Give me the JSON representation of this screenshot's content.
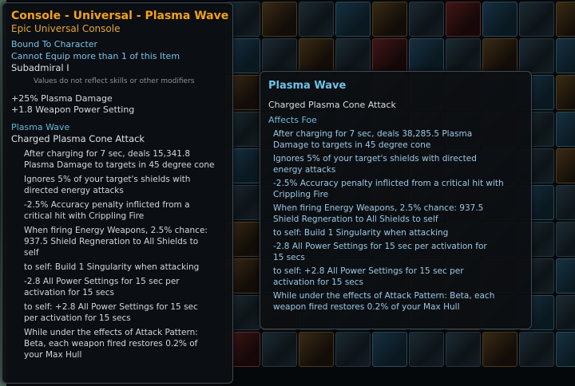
{
  "item_tooltip": {
    "title": "Console - Universal - Plasma Wave",
    "rarity": "Epic Universal Console",
    "binding": "Bound To Character",
    "equip_limit": "Cannot Equip more than 1 of this Item",
    "rank": "Subadmiral I",
    "note": "Values do not reflect skills or other modifiers",
    "bonuses": [
      "+25% Plasma Damage",
      "+1.8 Weapon Power Setting"
    ],
    "ability_name": "Plasma Wave",
    "ability_type": "Charged Plasma Cone Attack",
    "effects": [
      "After charging for 7 sec, deals 15,341.8\nPlasma Damage to targets in 45 degree cone",
      "Ignores 5% of your target's shields with\ndirected energy attacks",
      "-2.5% Accuracy penalty inflicted from a\ncritical hit with Crippling Fire",
      "When firing Energy Weapons, 2.5% chance:\n937.5 Shield Regneration to All Shields to\nself",
      "to self: Build 1 Singularity when attacking",
      "-2.8 All Power Settings for 15 sec per\nactivation for 15 secs",
      "to self: +2.8 All Power Settings for 15 sec\nper activation for 15 secs",
      "While under the effects of Attack Pattern:\nBeta, each weapon fired restores 0.2% of\nyour Max Hull"
    ]
  },
  "ability_tooltip": {
    "title": "Plasma Wave",
    "type": "Charged Plasma Cone Attack",
    "affects": "Affects Foe",
    "effects": [
      "After charging for 7 sec, deals 38,285.5 Plasma\nDamage to targets in 45 degree cone",
      "Ignores 5% of your target's shields with directed\nenergy attacks",
      "-2.5% Accuracy penalty inflicted from a critical hit with\nCrippling Fire",
      "When firing Energy Weapons, 2.5% chance: 937.5\nShield Regneration to All Shields to self",
      "to self: Build 1 Singularity when attacking",
      "-2.8 All Power Settings for 15 sec per activation for\n15 secs",
      "to self: +2.8 All Power Settings for 15 sec per\nactivation for 15 secs",
      "While under the effects of Attack Pattern: Beta, each\nweapon fired restores 0.2% of your Max Hull"
    ]
  },
  "colors": {
    "title_orange": "#f2a21c",
    "rarity_orange": "#e2a838",
    "info_blue": "#7cc0e8",
    "ability_blue": "#6fc3e8"
  }
}
